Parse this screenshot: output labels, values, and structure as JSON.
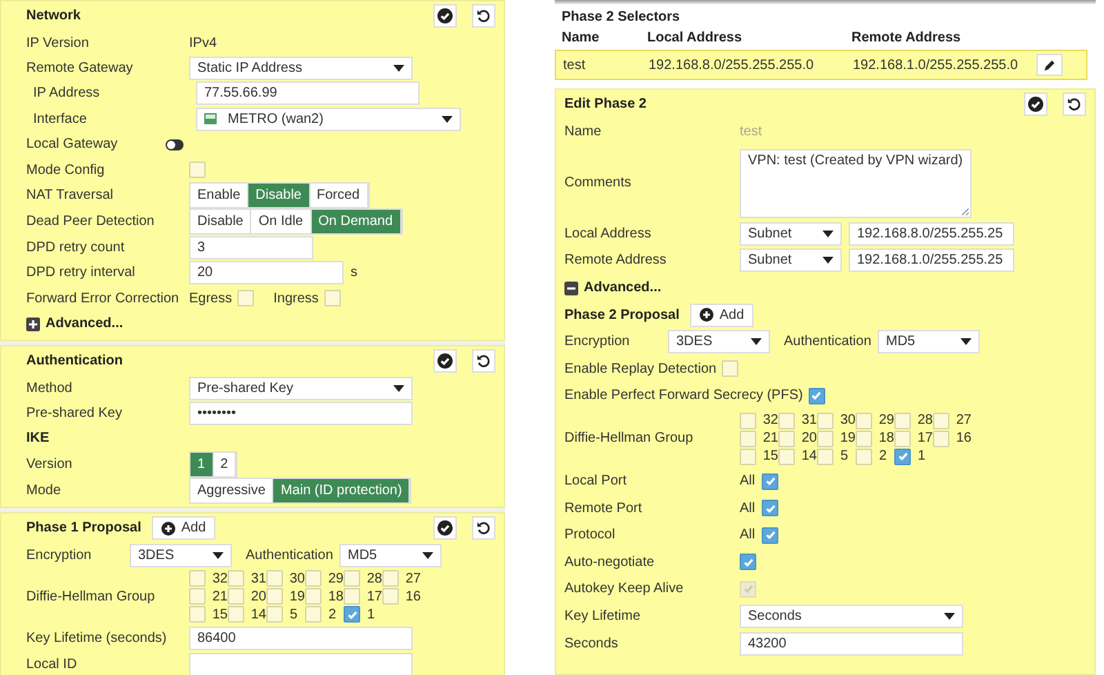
{
  "left_panels": [
    {
      "title": "Network",
      "rows": [
        {
          "kind": "text",
          "label": "IP Version",
          "value": "IPv4",
          "disabled": false
        },
        {
          "kind": "select",
          "label": "Remote Gateway",
          "value": "Static IP Address",
          "children": [
            {
              "kind": "input",
              "label": "IP Address",
              "value": "77.55.66.99"
            },
            {
              "kind": "iface",
              "label": "Interface",
              "value": "METRO (wan2)"
            }
          ]
        },
        {
          "kind": "toggle",
          "label": "Local Gateway",
          "on": false
        },
        {
          "kind": "checkbox",
          "label": "Mode Config",
          "checked": false,
          "disabled": false
        },
        {
          "kind": "segmented",
          "label": "NAT Traversal",
          "options": [
            {
              "label": "Enable",
              "selected": false
            },
            {
              "label": "Disable",
              "selected": true
            },
            {
              "label": "Forced",
              "selected": false
            }
          ]
        },
        {
          "kind": "segmented",
          "label": "Dead Peer Detection",
          "options": [
            {
              "label": "Disable",
              "selected": false
            },
            {
              "label": "On Idle",
              "selected": false
            },
            {
              "label": "On Demand",
              "selected": true
            }
          ]
        },
        {
          "kind": "number",
          "label": "DPD retry count",
          "value": "3"
        },
        {
          "kind": "number",
          "label": "DPD retry interval",
          "value": "20",
          "unit": "s"
        },
        {
          "kind": "checks",
          "label": "Forward Error Correction",
          "options": [
            {
              "label": "Egress",
              "checked": false
            },
            {
              "label": "Ingress",
              "checked": false
            }
          ]
        },
        {
          "kind": "advanced",
          "label": "Advanced...",
          "expanded": false
        }
      ]
    },
    {
      "title": "Authentication",
      "rows": [
        {
          "kind": "select",
          "label": "Method",
          "value": "Pre-shared Key"
        },
        {
          "kind": "input",
          "label": "Pre-shared Key",
          "value": "••••••••"
        },
        {
          "kind": "heading",
          "label": "IKE"
        },
        {
          "kind": "segmented",
          "label": "Version",
          "options": [
            {
              "label": "1",
              "selected": true
            },
            {
              "label": "2",
              "selected": false
            }
          ]
        },
        {
          "kind": "segmented",
          "label": "Mode",
          "options": [
            {
              "label": "Aggressive",
              "selected": false
            },
            {
              "label": "Main (ID protection)",
              "selected": true
            }
          ]
        }
      ]
    },
    {
      "title": "Phase 1 Proposal",
      "add_button": "Add",
      "rows": [
        {
          "kind": "proposal",
          "fields": [
            {
              "label": "Encryption",
              "value": "3DES"
            },
            {
              "label": "Authentication",
              "value": "MD5"
            }
          ]
        },
        {
          "kind": "dh",
          "label": "Diffie-Hellman Group",
          "options": [
            {
              "label": "32",
              "checked": false
            },
            {
              "label": "31",
              "checked": false
            },
            {
              "label": "30",
              "checked": false
            },
            {
              "label": "29",
              "checked": false
            },
            {
              "label": "28",
              "checked": false
            },
            {
              "label": "27",
              "checked": false
            },
            {
              "label": "21",
              "checked": false
            },
            {
              "label": "20",
              "checked": false
            },
            {
              "label": "19",
              "checked": false
            },
            {
              "label": "18",
              "checked": false
            },
            {
              "label": "17",
              "checked": false
            },
            {
              "label": "16",
              "checked": false
            },
            {
              "label": "15",
              "checked": false
            },
            {
              "label": "14",
              "checked": false
            },
            {
              "label": "5",
              "checked": false
            },
            {
              "label": "2",
              "checked": false
            },
            {
              "label": "1",
              "checked": true
            }
          ]
        },
        {
          "kind": "input",
          "label": "Key Lifetime (seconds)",
          "value": "86400"
        },
        {
          "kind": "input",
          "label": "Local ID"
        }
      ]
    }
  ],
  "selectors": {
    "title": "Phase 2 Selectors",
    "columns": [
      "Name",
      "Local Address",
      "Remote Address"
    ],
    "rows": [
      {
        "cells": [
          "test",
          "192.168.8.0/255.255.255.0",
          "192.168.1.0/255.255.255.0"
        ],
        "selected": true
      }
    ]
  },
  "edit_panel": {
    "title": "Edit Phase 2",
    "rows": [
      {
        "kind": "text",
        "label": "Name",
        "value": "test",
        "disabled": true
      },
      {
        "kind": "textarea",
        "label": "Comments",
        "value": "VPN: test (Created by VPN wizard)"
      },
      {
        "kind": "address",
        "label": "Local Address",
        "type": "Subnet",
        "value": "192.168.8.0/255.255.25"
      },
      {
        "kind": "address",
        "label": "Remote Address",
        "type": "Subnet",
        "value": "192.168.1.0/255.255.25"
      },
      {
        "kind": "advanced",
        "label": "Advanced...",
        "expanded": true
      },
      {
        "kind": "subheading",
        "label": "Phase 2 Proposal",
        "add_button": "Add"
      },
      {
        "kind": "proposal",
        "fields": [
          {
            "label": "Encryption",
            "value": "3DES"
          },
          {
            "label": "Authentication",
            "value": "MD5"
          }
        ]
      },
      {
        "kind": "inline-check",
        "label": "Enable Replay Detection",
        "checked": false
      },
      {
        "kind": "inline-check",
        "label": "Enable Perfect Forward Secrecy (PFS)",
        "checked": true
      },
      {
        "kind": "dh",
        "label": "Diffie-Hellman Group",
        "options": [
          {
            "label": "32",
            "checked": false
          },
          {
            "label": "31",
            "checked": false
          },
          {
            "label": "30",
            "checked": false
          },
          {
            "label": "29",
            "checked": false
          },
          {
            "label": "28",
            "checked": false
          },
          {
            "label": "27",
            "checked": false
          },
          {
            "label": "21",
            "checked": false
          },
          {
            "label": "20",
            "checked": false
          },
          {
            "label": "19",
            "checked": false
          },
          {
            "label": "18",
            "checked": false
          },
          {
            "label": "17",
            "checked": false
          },
          {
            "label": "16",
            "checked": false
          },
          {
            "label": "15",
            "checked": false
          },
          {
            "label": "14",
            "checked": false
          },
          {
            "label": "5",
            "checked": false
          },
          {
            "label": "2",
            "checked": false
          },
          {
            "label": "1",
            "checked": true
          }
        ]
      },
      {
        "kind": "all-check",
        "label": "Local Port",
        "text": "All",
        "checked": true
      },
      {
        "kind": "all-check",
        "label": "Remote Port",
        "text": "All",
        "checked": true
      },
      {
        "kind": "all-check",
        "label": "Protocol",
        "text": "All",
        "checked": true
      },
      {
        "kind": "checkbox",
        "label": "Auto-negotiate",
        "checked": true,
        "disabled": false
      },
      {
        "kind": "checkbox",
        "label": "Autokey Keep Alive",
        "checked": true,
        "disabled": true
      },
      {
        "kind": "select",
        "label": "Key Lifetime",
        "value": "Seconds"
      },
      {
        "kind": "input",
        "label": "Seconds",
        "value": "43200"
      }
    ]
  }
}
